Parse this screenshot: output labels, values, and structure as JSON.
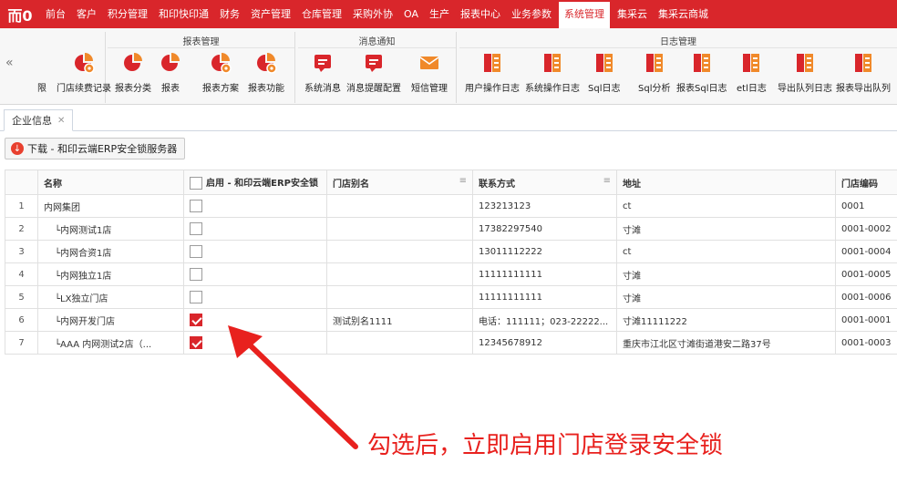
{
  "nav": {
    "logo": "而0",
    "items": [
      "前台",
      "客户",
      "积分管理",
      "和印快印通",
      "财务",
      "资产管理",
      "仓库管理",
      "采购外协",
      "OA",
      "生产",
      "报表中心",
      "业务参数",
      "系统管理",
      "集采云",
      "集采云商城"
    ],
    "active": "系统管理"
  },
  "ribbon": {
    "groups": [
      {
        "title": "报表管理"
      },
      {
        "title": "消息通知"
      },
      {
        "title": "日志管理"
      }
    ],
    "buttons": [
      "限",
      "门店续费记录",
      "报表分类",
      "报表",
      "报表方案",
      "报表功能",
      "系统消息",
      "消息提醒配置",
      "短信管理",
      "用户操作日志",
      "系统操作日志",
      "Sql日志",
      "Sql分析",
      "报表Sql日志",
      "etl日志",
      "导出队列日志",
      "报表导出队列"
    ]
  },
  "tab": {
    "label": "企业信息",
    "close": "✕"
  },
  "toolbar": {
    "download_label": "下载 - 和印云端ERP安全锁服务器"
  },
  "table": {
    "headers": [
      "",
      "名称",
      "启用 - 和印云端ERP安全锁",
      "门店别名",
      "联系方式",
      "地址",
      "门店编码"
    ],
    "rows": [
      {
        "num": "1",
        "name": "内网集团",
        "enabled": false,
        "alias": "",
        "contact": "123213123",
        "address": "ct",
        "code": "0001"
      },
      {
        "num": "2",
        "name": "内网测试1店",
        "enabled": false,
        "alias": "",
        "contact": "17382297540",
        "address": "寸滩",
        "code": "0001-0002"
      },
      {
        "num": "3",
        "name": "内网合资1店",
        "enabled": false,
        "alias": "",
        "contact": "13011112222",
        "address": "ct",
        "code": "0001-0004"
      },
      {
        "num": "4",
        "name": "内网独立1店",
        "enabled": false,
        "alias": "",
        "contact": "11111111111",
        "address": "寸滩",
        "code": "0001-0005"
      },
      {
        "num": "5",
        "name": "LX独立门店",
        "enabled": false,
        "alias": "",
        "contact": "11111111111",
        "address": "寸滩",
        "code": "0001-0006"
      },
      {
        "num": "6",
        "name": "内网开发门店",
        "enabled": true,
        "alias": "测试别名1111",
        "contact": "电话：111111；023-22222...",
        "address": "寸滩11111222",
        "code": "0001-0001"
      },
      {
        "num": "7",
        "name": "AAA 内网测试2店（...",
        "enabled": true,
        "alias": "",
        "contact": "12345678912",
        "address": "重庆市江北区寸滩街道港安二路37号",
        "code": "0001-0003"
      }
    ]
  },
  "annotation": {
    "text": "勾选后，立即启用门店登录安全锁",
    "color": "#e8211e"
  },
  "colors": {
    "brand": "#d9262b",
    "accent_orange": "#f0892a"
  }
}
